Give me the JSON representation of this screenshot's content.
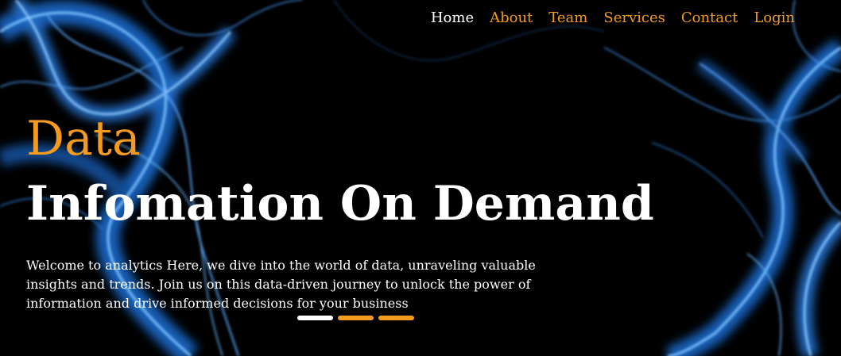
{
  "nav": {
    "items": [
      {
        "label": "Home"
      },
      {
        "label": "About"
      },
      {
        "label": "Team"
      },
      {
        "label": "Services"
      },
      {
        "label": "Contact"
      },
      {
        "label": "Login"
      }
    ]
  },
  "hero": {
    "eyebrow": "Data",
    "headline": "Infomation On Demand",
    "intro": "Welcome to analytics Here, we dive into the world of data, unraveling valuable insights and trends. Join us on this data-driven journey to unlock the power of information and drive informed decisions for your business",
    "active_slide": 1,
    "slide_count": 3
  },
  "colors": {
    "accent": "#f39a1f",
    "text": "#ffffff",
    "background": "#000000",
    "glow": "#3aa0ff"
  }
}
